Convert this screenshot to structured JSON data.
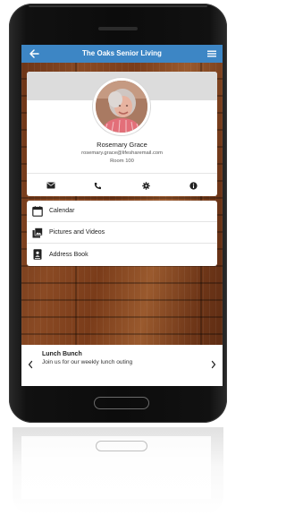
{
  "app": {
    "title": "The Oaks Senior Living"
  },
  "colors": {
    "appbar": "#3d86c5",
    "background": "#7a3c1a",
    "card": "#ffffff"
  },
  "icons": {
    "back": "arrow-left-icon",
    "menu": "hamburger-menu-icon",
    "email": "envelope-icon",
    "phone": "phone-icon",
    "settings": "gear-icon",
    "info": "info-icon"
  },
  "profile": {
    "name": "Rosemary Grace",
    "email": "rosemary.grace@lifesharemail.com",
    "room": "Room 100"
  },
  "menu_items": [
    {
      "label": "Calendar",
      "icon": "calendar-icon"
    },
    {
      "label": "Pictures and Videos",
      "icon": "photo-icon"
    },
    {
      "label": "Address Book",
      "icon": "address-book-icon"
    }
  ],
  "carousel": {
    "title": "Lunch Bunch",
    "text": "Join us for our weekly lunch outing"
  }
}
